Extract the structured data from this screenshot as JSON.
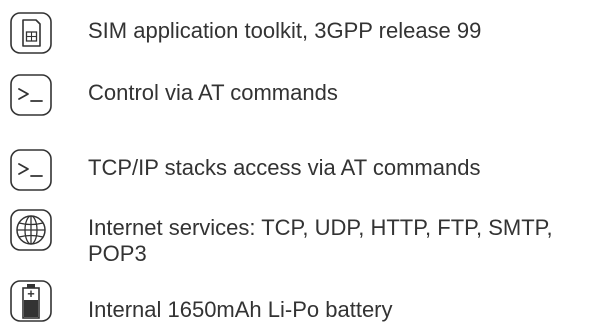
{
  "features": [
    {
      "icon": "sim-card-icon",
      "text": "SIM application toolkit, 3GPP release 99"
    },
    {
      "icon": "terminal-prompt-icon",
      "text": "Control via AT commands"
    },
    {
      "icon": "terminal-prompt-icon",
      "text": "TCP/IP stacks access via AT commands"
    },
    {
      "icon": "globe-icon",
      "text": "Internet services: TCP, UDP, HTTP, FTP, SMTP, POP3"
    },
    {
      "icon": "battery-icon",
      "text": "Internal 1650mAh Li-Po battery"
    }
  ],
  "colors": {
    "text": "#333333",
    "icon_stroke": "#333333",
    "background": "#ffffff"
  }
}
